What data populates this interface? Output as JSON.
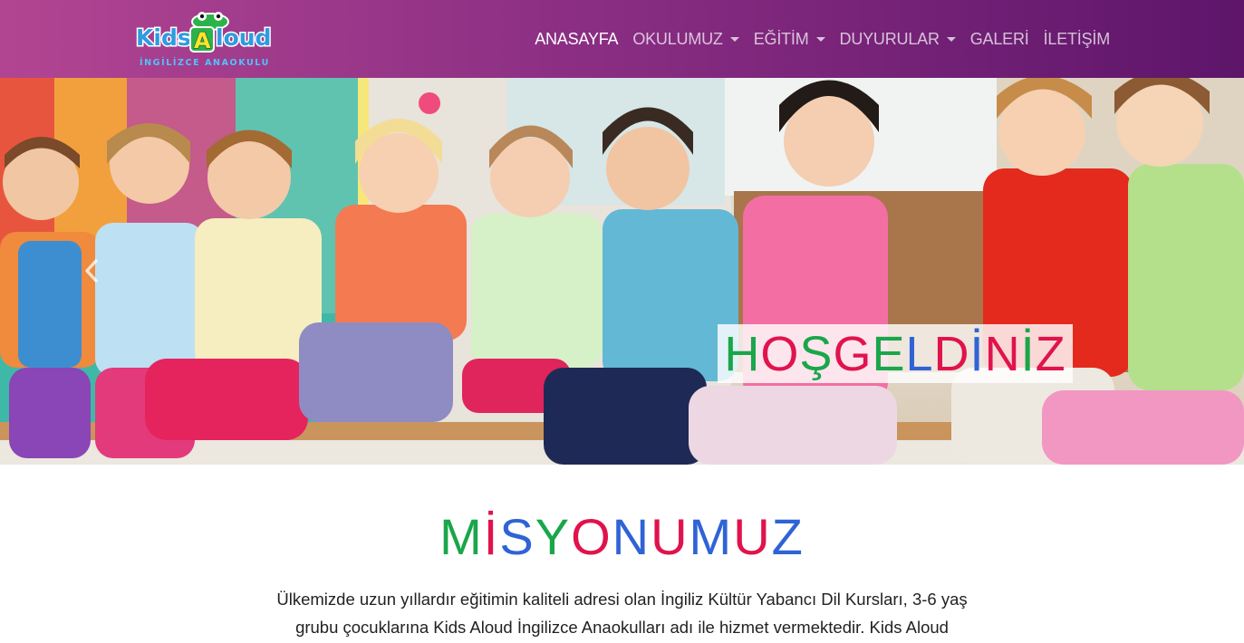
{
  "brand": {
    "logo_text_part1": "Kids",
    "logo_text_letter": "A",
    "logo_text_part2": "loud",
    "logo_subtitle": "İNGİLİZCE ANAOKULU"
  },
  "nav": {
    "items": [
      {
        "label": "ANASAYFA",
        "active": true,
        "dropdown": false
      },
      {
        "label": "OKULUMUZ",
        "active": false,
        "dropdown": true
      },
      {
        "label": "EĞİTİM",
        "active": false,
        "dropdown": true
      },
      {
        "label": "DUYURULAR",
        "active": false,
        "dropdown": true
      },
      {
        "label": "GALERİ",
        "active": false,
        "dropdown": false
      },
      {
        "label": "İLETİŞİM",
        "active": false,
        "dropdown": false
      }
    ]
  },
  "hero": {
    "welcome": "HOŞGELDİNİZ",
    "prev_icon": "chevron-left-icon"
  },
  "mission": {
    "title": "MİSYONUMUZ",
    "text": "Ülkemizde uzun yıllardır eğitimin kaliteli adresi olan İngiliz Kültür Yabancı Dil Kursları, 3-6 yaş grubu çocuklarına Kids Aloud İngilizce Anaokulları adı ile hizmet vermektedir. Kids Aloud"
  },
  "colors": {
    "nav_start": "#b24592",
    "nav_end": "#5d156a",
    "letter_green": "#1aa64a",
    "letter_red": "#e0134d",
    "letter_blue": "#2f63d6"
  }
}
